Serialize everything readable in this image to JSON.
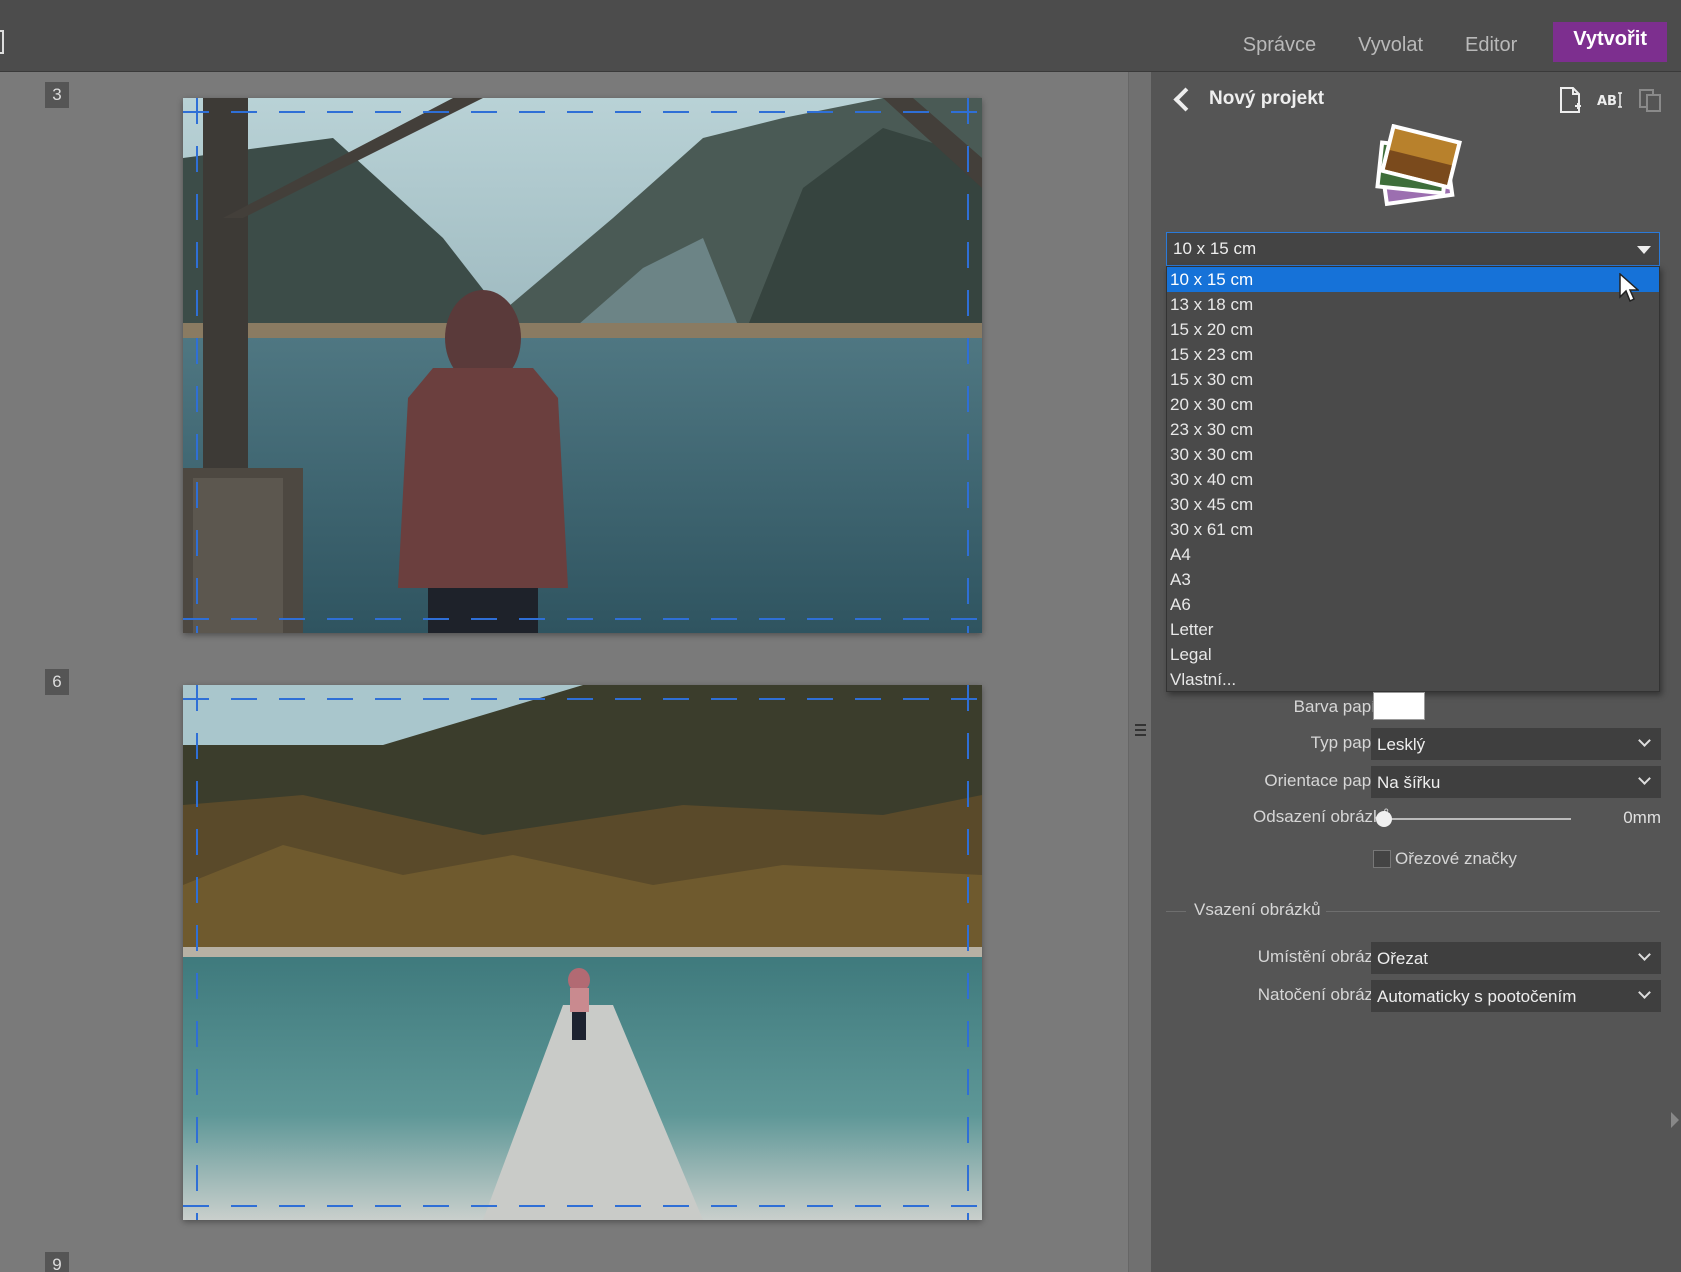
{
  "topbar": {
    "tabs": [
      {
        "label": "Správce",
        "active": false
      },
      {
        "label": "Vyvolat",
        "active": false
      },
      {
        "label": "Editor",
        "active": false
      },
      {
        "label": "Vytvořit",
        "active": true
      }
    ],
    "accent_color": "#7d2f8f"
  },
  "canvas": {
    "pages": [
      {
        "number": "3"
      },
      {
        "number": "6"
      },
      {
        "number": "9"
      }
    ],
    "crop_guide_color": "#2f6fd6"
  },
  "panel": {
    "title": "Nový projekt",
    "icons": [
      "new-page-icon",
      "text-tool-icon",
      "copy-page-icon"
    ],
    "format_select": {
      "value": "10 x 15 cm",
      "options": [
        "10 x 15 cm",
        "13 x 18 cm",
        "15 x 20 cm",
        "15 x 23 cm",
        "15 x 30 cm",
        "20 x 30 cm",
        "23 x 30 cm",
        "30 x 30 cm",
        "30 x 40 cm",
        "30 x 45 cm",
        "30 x 61 cm",
        "A4",
        "A3",
        "A6",
        "Letter",
        "Legal",
        "Vlastní..."
      ],
      "highlight_color": "#1672d8"
    },
    "paper_color": {
      "label": "Barva papíru",
      "value": "#ffffff"
    },
    "paper_type": {
      "label": "Typ papíru",
      "value": "Lesklý"
    },
    "paper_orientation": {
      "label": "Orientace papíru",
      "value": "Na šířku"
    },
    "image_offset": {
      "label": "Odsazení obrázků",
      "value": "0mm",
      "level": 0
    },
    "crop_marks": {
      "label": "Ořezové značky",
      "checked": false
    },
    "image_fit_section": {
      "title": "Vsazení obrázků"
    },
    "image_placement": {
      "label": "Umístění obrázků",
      "value": "Ořezat"
    },
    "image_rotation": {
      "label": "Natočení obrázků",
      "value": "Automaticky s pootočením"
    }
  }
}
